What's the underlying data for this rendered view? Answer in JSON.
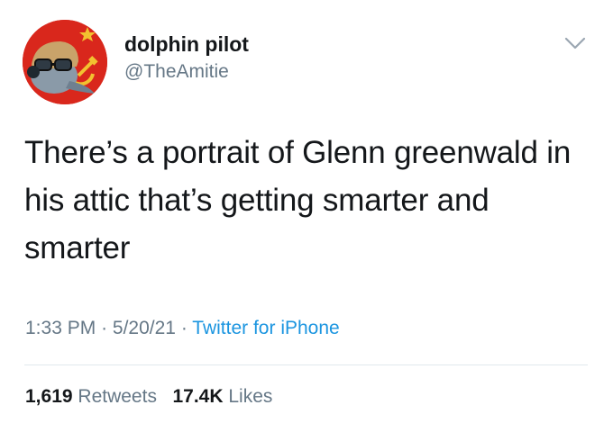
{
  "author": {
    "display_name": "dolphin pilot",
    "handle": "@TheAmitie",
    "avatar_icon": "dolphin-pilot-avatar-icon"
  },
  "tweet": {
    "text": "There’s a portrait of Glenn greenwald in his attic that’s getting smarter and smarter"
  },
  "meta": {
    "time": "1:33 PM",
    "date": "5/20/21",
    "separator": "·",
    "source": "Twitter for iPhone"
  },
  "stats": {
    "retweets_count": "1,619",
    "retweets_label": "Retweets",
    "likes_count": "17.4K",
    "likes_label": "Likes"
  },
  "colors": {
    "text": "#14171a",
    "secondary": "#657786",
    "link": "#1b95e0",
    "divider": "#e1e8ed",
    "avatar_bg": "#d9271c"
  }
}
